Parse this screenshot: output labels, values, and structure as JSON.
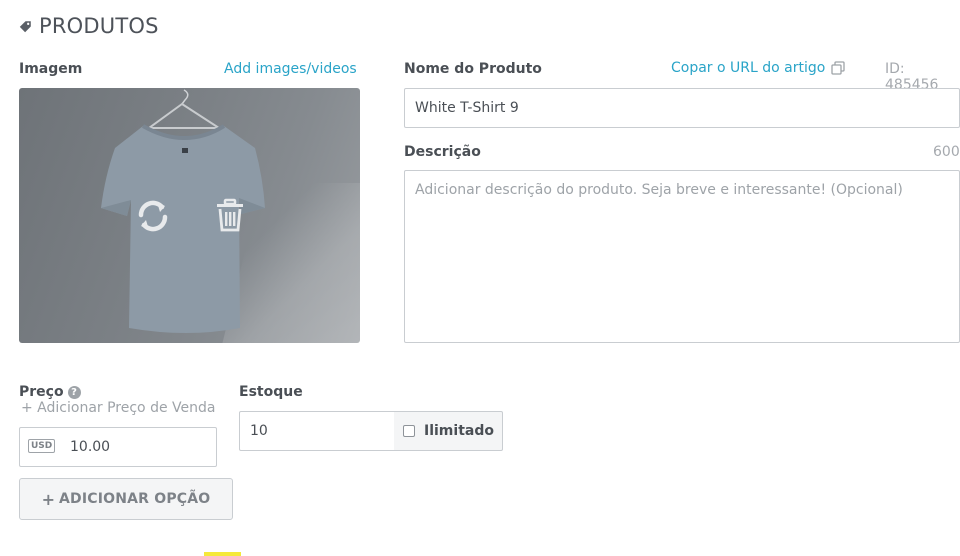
{
  "section": {
    "title": "PRODUTOS",
    "icon": "tag-icon"
  },
  "image": {
    "label": "Imagem",
    "add_link": "Add images/videos",
    "overlay_icons": [
      "refresh-icon",
      "trash-icon"
    ]
  },
  "product": {
    "name_label": "Nome do Produto",
    "copy_url_link": "Copar o URL do artigo",
    "copy_icon": "copy-icon",
    "id_text": "ID: 485456",
    "name_value": "White T-Shirt 9"
  },
  "description": {
    "label": "Descrição",
    "char_limit": "600",
    "placeholder": "Adicionar descrição do produto. Seja breve e interessante! (Opcional)"
  },
  "price": {
    "label": "Preço",
    "help_icon": "?",
    "add_sale_price": "+ Adicionar Preço de Venda",
    "currency": "USD",
    "value": "10.00"
  },
  "stock": {
    "label": "Estoque",
    "value": "10",
    "unlimited_label": "Ilimitado",
    "unlimited_checked": false
  },
  "add_option": {
    "plus": "+",
    "label": "ADICIONAR OPÇÃO"
  },
  "colors": {
    "accent": "#2aa4c8",
    "text": "#4a4f55",
    "muted": "#a5a9ae",
    "border": "#c9cdd1"
  }
}
